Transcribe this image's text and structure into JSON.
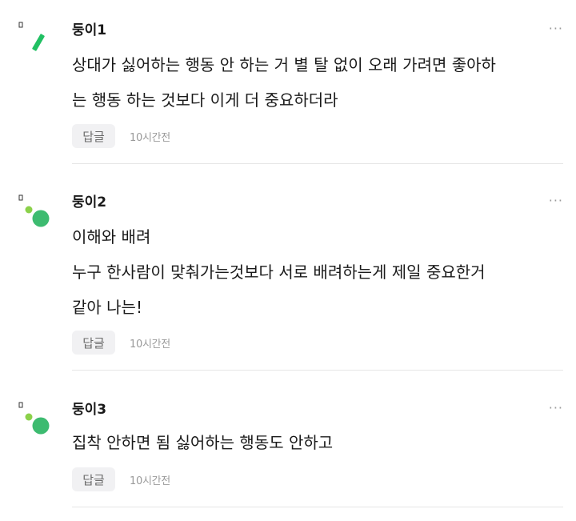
{
  "comments": [
    {
      "author": "둥이1",
      "lines": [
        "상대가 싫어하는 행동 안 하는 거 별 탈 없이 오래 가려면 좋아하",
        "는 행동 하는 것보다 이게 더 중요하더라"
      ],
      "reply_label": "답글",
      "time": "10시간전",
      "more_label": "···",
      "avatar_colors": {
        "main": "#21c063",
        "dot": "#8bd14a"
      }
    },
    {
      "author": "둥이2",
      "lines": [
        "이해와 배려",
        "누구 한사람이 맞춰가는것보다 서로 배려하는게 제일 중요한거",
        "같아 나는!"
      ],
      "reply_label": "답글",
      "time": "10시간전",
      "more_label": "···",
      "avatar_colors": {
        "main": "#3dbb70",
        "dot": "#8bd14a"
      }
    },
    {
      "author": "둥이3",
      "lines": [
        "집착 안하면 됨 싫어하는 행동도 안하고"
      ],
      "reply_label": "답글",
      "time": "10시간전",
      "more_label": "···",
      "avatar_colors": {
        "main": "#3dbb70",
        "dot": "#8bd14a"
      }
    }
  ]
}
